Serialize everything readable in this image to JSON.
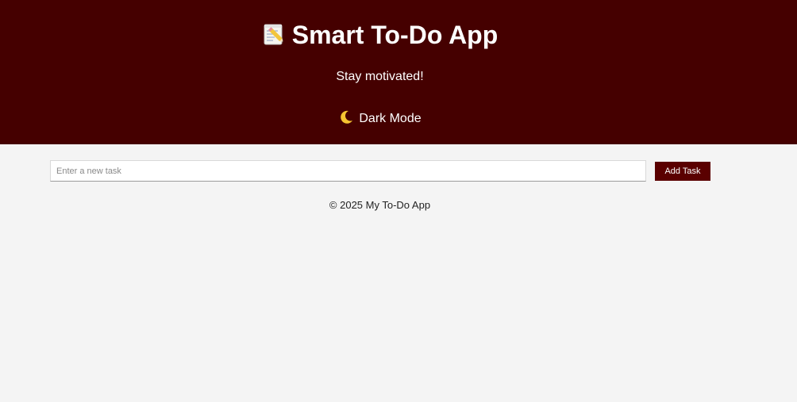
{
  "header": {
    "title_emoji_icon": "memo-pencil-icon",
    "title": "Smart To-Do App",
    "subtitle": "Stay motivated!",
    "mode_toggle": {
      "icon": "crescent-moon-icon",
      "label": "Dark Mode"
    },
    "background_color": "#450000"
  },
  "task_form": {
    "input_value": "",
    "input_placeholder": "Enter a new task",
    "add_button_label": "Add Task",
    "button_color": "#5a0000"
  },
  "footer": {
    "text": "© 2025 My To-Do App"
  }
}
